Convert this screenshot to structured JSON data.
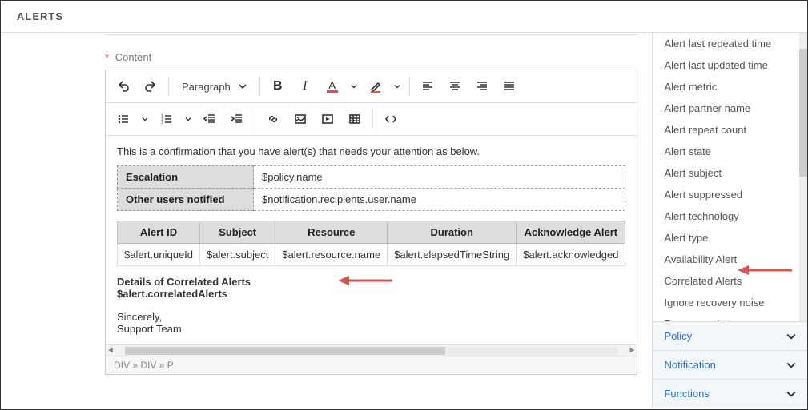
{
  "header": {
    "title": "ALERTS"
  },
  "field": {
    "content_label": "Content"
  },
  "toolbar": {
    "block_format": "Paragraph"
  },
  "editor": {
    "intro": "This is a confirmation that you have alert(s) that needs your attention as below.",
    "meta_rows": [
      {
        "label": "Escalation",
        "value": "$policy.name"
      },
      {
        "label": "Other users notified",
        "value": "$notification.recipients.user.name"
      }
    ],
    "table": {
      "headers": [
        "Alert ID",
        "Subject",
        "Resource",
        "Duration",
        "Acknowledge Alert"
      ],
      "row": [
        "$alert.uniqueId",
        "$alert.subject",
        "$alert.resource.name",
        "$alert.elapsedTimeString",
        "$alert.acknowledged"
      ]
    },
    "details_heading": "Details of Correlated Alerts",
    "details_var": "$alert.correlatedAlerts",
    "signoff1": "Sincerely,",
    "signoff2": "Support Team"
  },
  "breadcrumb": "DIV » DIV » P",
  "variables": [
    "Alert last repeated time",
    "Alert last updated time",
    "Alert metric",
    "Alert partner name",
    "Alert repeat count",
    "Alert state",
    "Alert subject",
    "Alert suppressed",
    "Alert technology",
    "Alert type",
    "Availability Alert",
    "Correlated Alerts",
    "Ignore recovery noise",
    "Recovery alert"
  ],
  "panels": [
    {
      "label": "Policy"
    },
    {
      "label": "Notification"
    },
    {
      "label": "Functions"
    }
  ]
}
